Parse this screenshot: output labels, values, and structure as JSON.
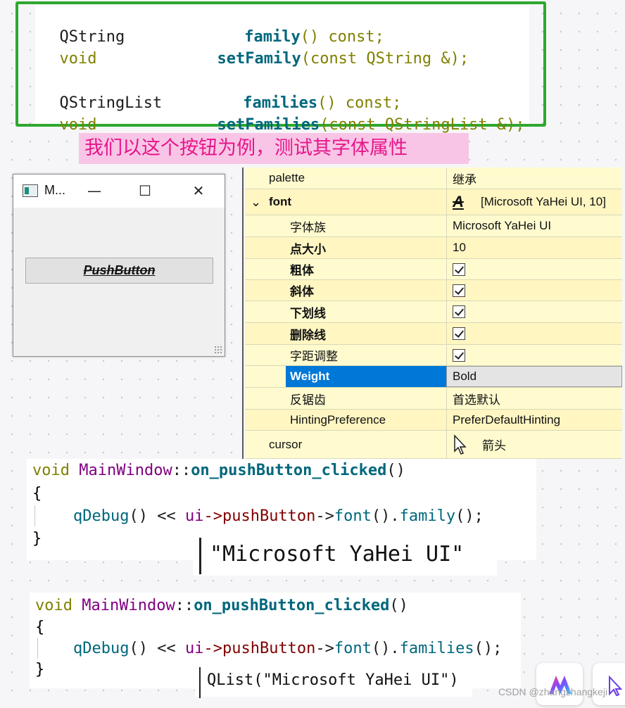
{
  "top_code": {
    "lines": [
      {
        "type": "QString",
        "func": "family",
        "rest": "() const;"
      },
      {
        "type": "void",
        "func": "setFamily",
        "rest": "(const QString &);"
      },
      {
        "type": "QStringList",
        "func": "families",
        "rest": "() const;"
      },
      {
        "type": "void",
        "func": "setFamilies",
        "rest": "(const QStringList &);"
      }
    ]
  },
  "caption": "我们以这个按钮为例，测试其字体属性",
  "mini_window": {
    "title": "M...",
    "min_glyph": "—",
    "max_glyph": "☐",
    "close_glyph": "✕",
    "button_label": "PushButton"
  },
  "property_editor": {
    "rows": [
      {
        "name": "palette",
        "value": "继承"
      },
      {
        "name": "font",
        "value": "[Microsoft YaHei UI, 10]",
        "expander": "⌄",
        "glyph": "A"
      },
      {
        "name": "字体族",
        "value": "Microsoft YaHei UI"
      },
      {
        "name": "点大小",
        "value": "10"
      },
      {
        "name": "粗体",
        "checked": true
      },
      {
        "name": "斜体",
        "checked": true
      },
      {
        "name": "下划线",
        "checked": true
      },
      {
        "name": "删除线",
        "checked": true
      },
      {
        "name": "字距调整",
        "checked": true
      },
      {
        "name": "Weight",
        "value": "Bold"
      },
      {
        "name": "反锯齿",
        "value": "首选默认"
      },
      {
        "name": "HintingPreference",
        "value": "PreferDefaultHinting"
      },
      {
        "name": "cursor",
        "value": "箭头"
      }
    ]
  },
  "snippet1": {
    "line1": {
      "void": "void",
      "cls": "MainWindow",
      "sep": "::",
      "fn": "on_pushButton_clicked",
      "tail": "()"
    },
    "open": "{",
    "line3": {
      "call": "qDebug",
      "a": "() << ",
      "ui": "ui",
      "arrow1": "->",
      "btn": "pushButton",
      "arrow2": "->",
      "font": "font",
      "dot": "().",
      "member": "family",
      "end": "();"
    },
    "close": "}",
    "output": "\"Microsoft YaHei UI\""
  },
  "snippet2": {
    "line1": {
      "void": "void",
      "cls": "MainWindow",
      "sep": "::",
      "fn": "on_pushButton_clicked",
      "tail": "()"
    },
    "open": "{",
    "line3": {
      "call": "qDebug",
      "a": "() << ",
      "ui": "ui",
      "arrow1": "->",
      "btn": "pushButton",
      "arrow2": "->",
      "font": "font",
      "dot": "().",
      "member": "families",
      "end": "();"
    },
    "close": "}",
    "output": "QList(\"Microsoft YaHei UI\")"
  },
  "watermark": "CSDN @zhangzhangkeji",
  "colors": {
    "border_green": "#2ea82e",
    "caption_bg": "#f9c5e6",
    "caption_text": "#e6168a",
    "selected": "#0078d7"
  }
}
